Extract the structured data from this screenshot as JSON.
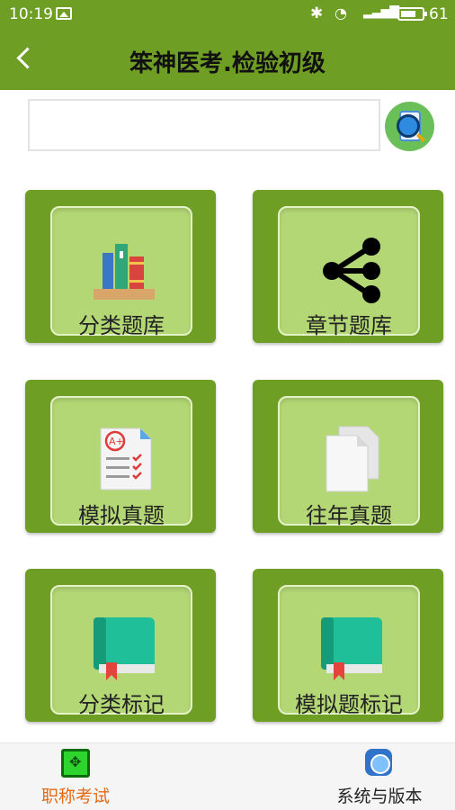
{
  "status_bar": {
    "time": "10:19",
    "battery": "61"
  },
  "header": {
    "title": "笨神医考.检验初级"
  },
  "search": {
    "value": "",
    "placeholder": ""
  },
  "tiles": [
    {
      "label": "分类题库",
      "icon": "books-icon"
    },
    {
      "label": "章节题库",
      "icon": "share-icon"
    },
    {
      "label": "模拟真题",
      "icon": "graded-test-icon"
    },
    {
      "label": "往年真题",
      "icon": "documents-icon"
    },
    {
      "label": "分类标记",
      "icon": "bookmark-book-icon"
    },
    {
      "label": "模拟题标记",
      "icon": "bookmark-book-icon"
    }
  ],
  "bottom_nav": [
    {
      "label": "职称考试",
      "active": true,
      "color": "#e26b17"
    },
    {
      "label": "系统与版本",
      "active": false
    }
  ],
  "colors": {
    "primary": "#6f9e24",
    "tile_inner": "#b4d775",
    "active_nav": "#e26b17"
  }
}
